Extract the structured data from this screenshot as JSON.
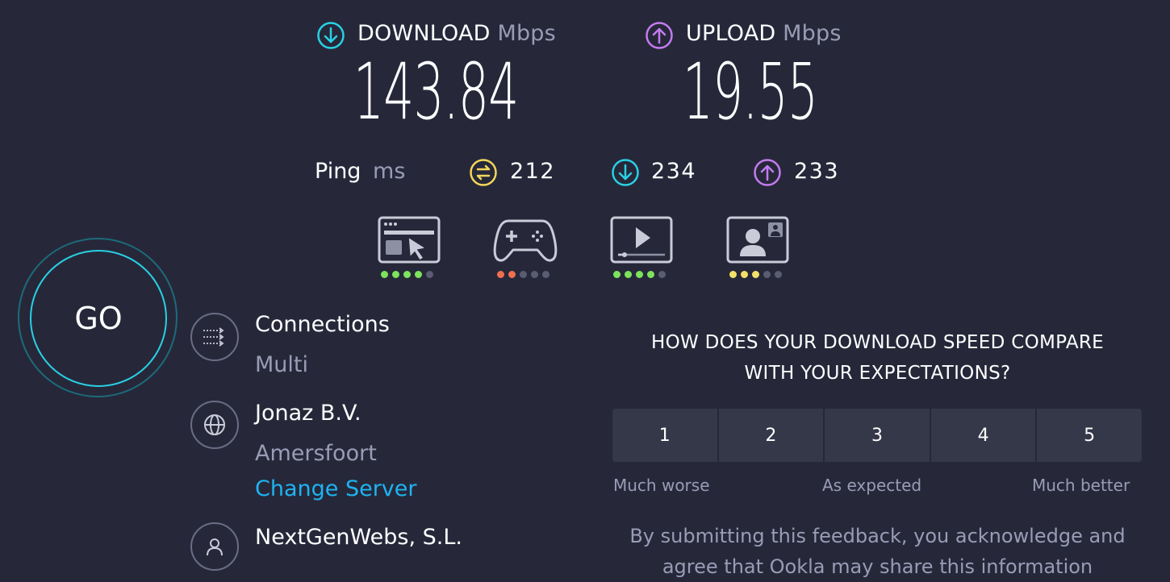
{
  "download": {
    "label": "DOWNLOAD",
    "unit": "Mbps",
    "value": "143.84",
    "icon": "arrow-down-circle-icon",
    "color": "#29d0e4"
  },
  "upload": {
    "label": "UPLOAD",
    "unit": "Mbps",
    "value": "19.55",
    "icon": "arrow-up-circle-icon",
    "color": "#c47bf0"
  },
  "ping": {
    "label": "Ping",
    "unit": "ms",
    "idle": {
      "value": "212",
      "icon": "idle-latency-icon",
      "color": "#f3d65a"
    },
    "download": {
      "value": "234",
      "icon": "arrow-down-circle-icon",
      "color": "#29d0e4"
    },
    "upload": {
      "value": "233",
      "icon": "arrow-up-circle-icon",
      "color": "#c47bf0"
    }
  },
  "quality": [
    {
      "name": "web-browsing-icon",
      "rating": 4,
      "of": 5,
      "color": "#7ee35c"
    },
    {
      "name": "gaming-icon",
      "rating": 2,
      "of": 5,
      "color": "#f06e50"
    },
    {
      "name": "video-streaming-icon",
      "rating": 4,
      "of": 5,
      "color": "#7ee35c"
    },
    {
      "name": "video-chat-icon",
      "rating": 3,
      "of": 5,
      "color": "#f3e06a"
    }
  ],
  "go_label": "GO",
  "connections": {
    "title": "Connections",
    "value": "Multi",
    "icon": "connections-icon"
  },
  "server": {
    "title": "Jonaz B.V.",
    "location": "Amersfoort",
    "change_label": "Change Server",
    "icon": "globe-icon"
  },
  "provider": {
    "title": "NextGenWebs, S.L.",
    "icon": "user-icon"
  },
  "survey": {
    "question_line1": "HOW DOES YOUR DOWNLOAD SPEED COMPARE",
    "question_line2": "WITH YOUR EXPECTATIONS?",
    "options": [
      "1",
      "2",
      "3",
      "4",
      "5"
    ],
    "label_low": "Much worse",
    "label_mid": "As expected",
    "label_high": "Much better",
    "disclaimer_line1": "By submitting this feedback, you acknowledge and",
    "disclaimer_line2": "agree that Ookla may share this information"
  }
}
